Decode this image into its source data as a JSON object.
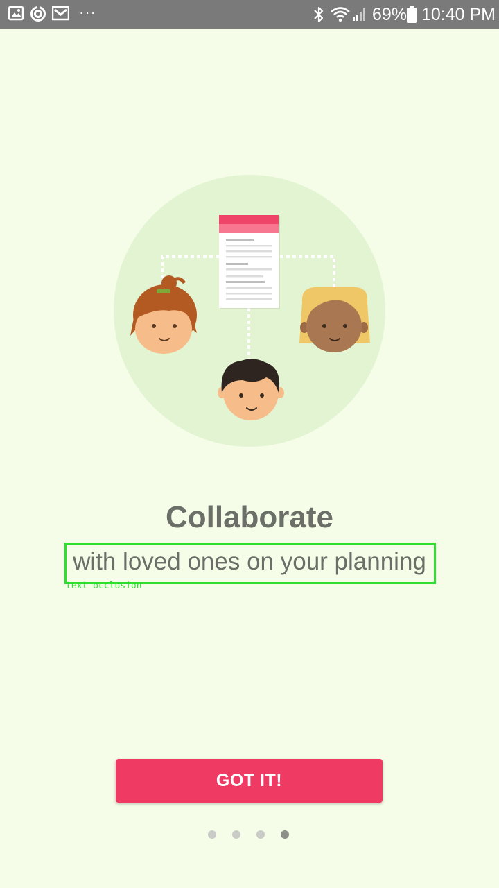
{
  "status_bar": {
    "icons_left": [
      "gallery-icon",
      "sync-icon",
      "gmail-icon",
      "more-notifications-icon"
    ],
    "more_glyph": "···",
    "icons_right": [
      "bluetooth-icon",
      "wifi-icon",
      "signal-icon",
      "battery-icon"
    ],
    "battery_percent": "69%",
    "time": "10:40 PM"
  },
  "onboarding": {
    "illustration": "collaboration-illustration",
    "title": "Collaborate",
    "subtitle": "with loved ones on your planning",
    "occlusion_label": "text occlusion",
    "cta_label": "GOT IT!",
    "pager": {
      "page_count": 4,
      "current_page": 4
    }
  },
  "colors": {
    "background": "#f5fde8",
    "accent": "#ef3a63",
    "title_text": "#6b6f68",
    "status_bar": "#7a7a7a",
    "occlusion_box": "#2ee02e"
  }
}
